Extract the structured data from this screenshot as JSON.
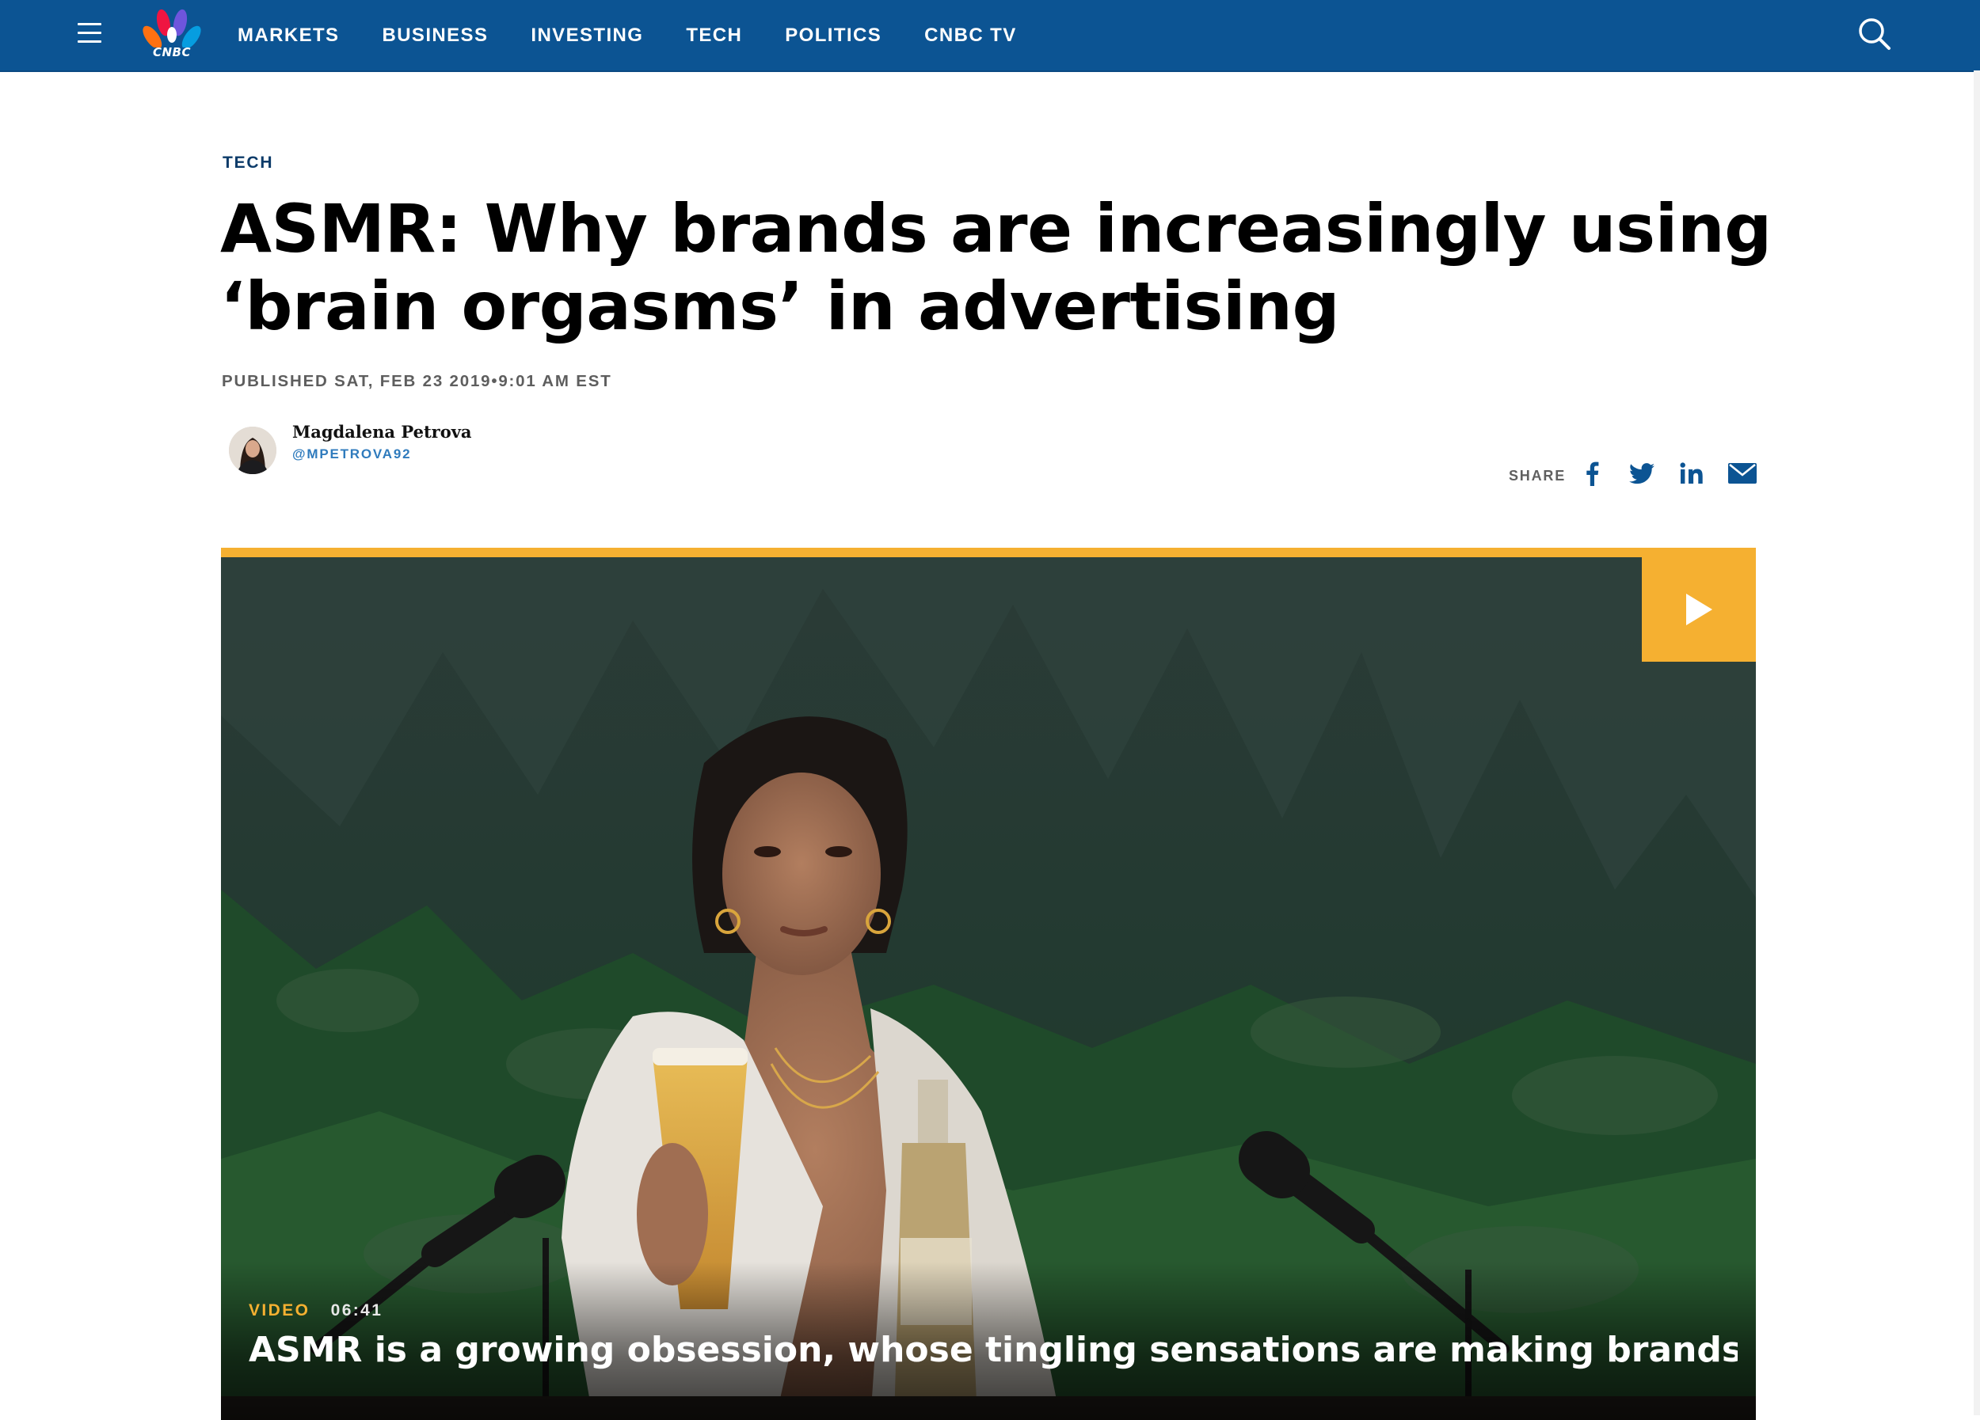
{
  "brand": {
    "logo_text": "CNBC",
    "primary_color": "#0c5493",
    "accent_color": "#f5b031"
  },
  "nav": {
    "items": [
      {
        "label": "MARKETS"
      },
      {
        "label": "BUSINESS"
      },
      {
        "label": "INVESTING"
      },
      {
        "label": "TECH"
      },
      {
        "label": "POLITICS"
      },
      {
        "label": "CNBC TV"
      }
    ],
    "menu_icon": "hamburger-menu-icon",
    "search_icon": "search-icon"
  },
  "article": {
    "kicker": "TECH",
    "headline_line1": "ASMR: Why brands are increasingly using",
    "headline_line2": "‘brain orgasms’ in advertising",
    "published": "PUBLISHED SAT, FEB 23 2019•9:01 AM EST",
    "author": {
      "name": "Magdalena Petrova",
      "handle": "@MPETROVA92"
    },
    "share": {
      "label": "SHARE",
      "icons": [
        "facebook-icon",
        "twitter-icon",
        "linkedin-icon",
        "email-icon"
      ]
    }
  },
  "video": {
    "tag": "VIDEO",
    "duration": "06:41",
    "title": "ASMR is a growing obsession, whose tingling sensations are making brands...",
    "play_icon": "play-icon"
  }
}
